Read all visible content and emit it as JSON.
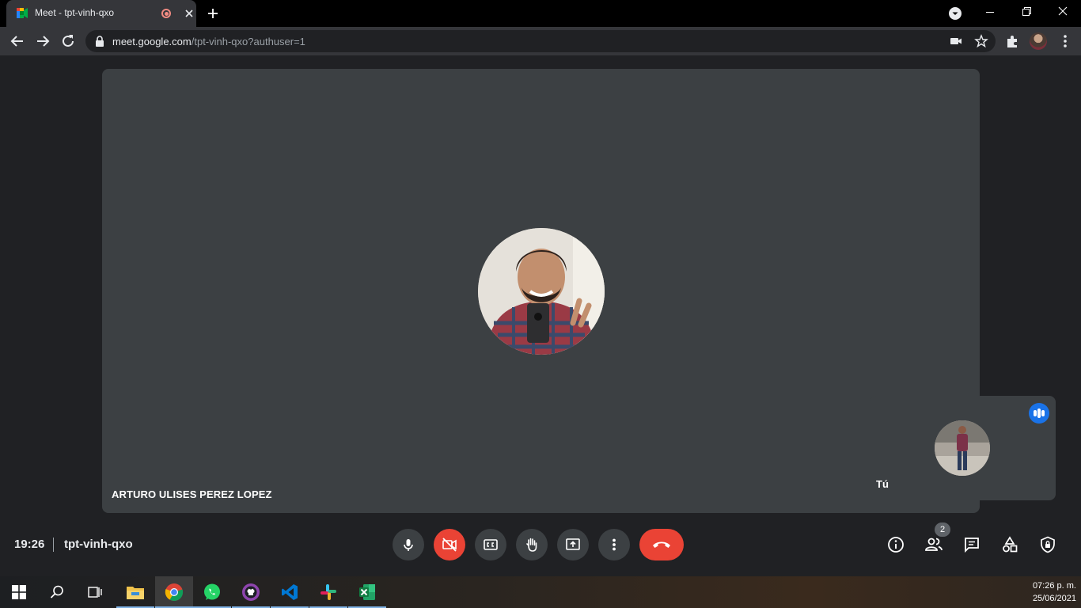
{
  "browser": {
    "tab_title": "Meet - tpt-vinh-qxo",
    "url_host": "meet.google.com",
    "url_path": "/tpt-vinh-qxo?authuser=1"
  },
  "meeting": {
    "main_participant_name": "ARTURO ULISES PEREZ LOPEZ",
    "self_label": "Tú",
    "time": "19:26",
    "code": "tpt-vinh-qxo",
    "participant_count": "2",
    "mic_on": true,
    "camera_on": false
  },
  "taskbar": {
    "apps": [
      "windows-start",
      "search",
      "task-view",
      "file-explorer",
      "chrome",
      "whatsapp",
      "github-desktop",
      "vscode",
      "slack",
      "excel"
    ],
    "active_app": "chrome",
    "time": "07:26 p. m.",
    "date": "25/06/2021"
  },
  "colors": {
    "stage_bg": "#3c4043",
    "page_bg": "#202124",
    "danger": "#ea4335",
    "accent": "#1a73e8"
  }
}
